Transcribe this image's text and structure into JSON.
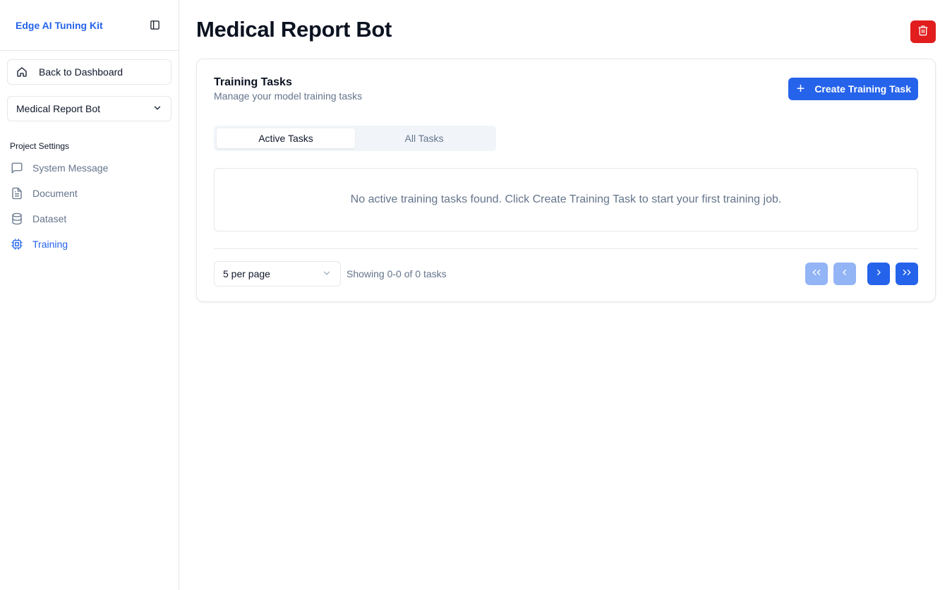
{
  "sidebar": {
    "brand": "Edge AI Tuning Kit",
    "back_button": "Back to Dashboard",
    "project_select": "Medical Report Bot",
    "section_label": "Project Settings",
    "nav": [
      {
        "label": "System Message",
        "icon": "message-square-icon",
        "active": false
      },
      {
        "label": "Document",
        "icon": "file-text-icon",
        "active": false
      },
      {
        "label": "Dataset",
        "icon": "database-icon",
        "active": false
      },
      {
        "label": "Training",
        "icon": "cpu-icon",
        "active": true
      }
    ]
  },
  "main": {
    "title": "Medical Report Bot",
    "card": {
      "title": "Training Tasks",
      "subtitle": "Manage your model training tasks",
      "create_button": "Create Training Task",
      "tabs": [
        {
          "label": "Active Tasks",
          "active": true
        },
        {
          "label": "All Tasks",
          "active": false
        }
      ],
      "empty_message": "No active training tasks found. Click Create Training Task to start your first training job.",
      "per_page": "5 per page",
      "showing": "Showing 0-0 of 0 tasks"
    }
  },
  "colors": {
    "accent": "#2563eb",
    "danger": "#e11d1d",
    "muted": "#64748b"
  }
}
